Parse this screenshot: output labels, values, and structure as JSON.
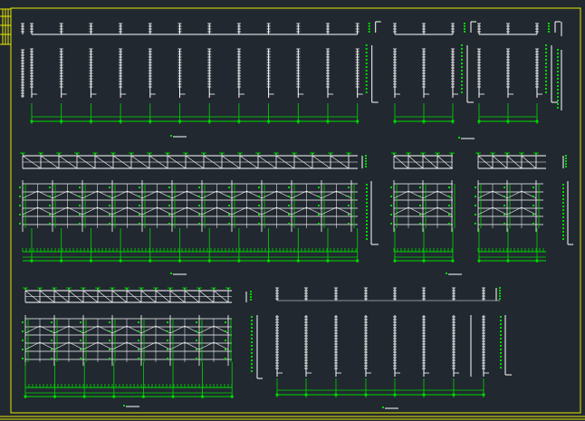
{
  "drawing": {
    "background": "#212830",
    "frame_color": "#e8e800",
    "line_color": "#ffffff",
    "dim_color": "#00d800"
  }
}
